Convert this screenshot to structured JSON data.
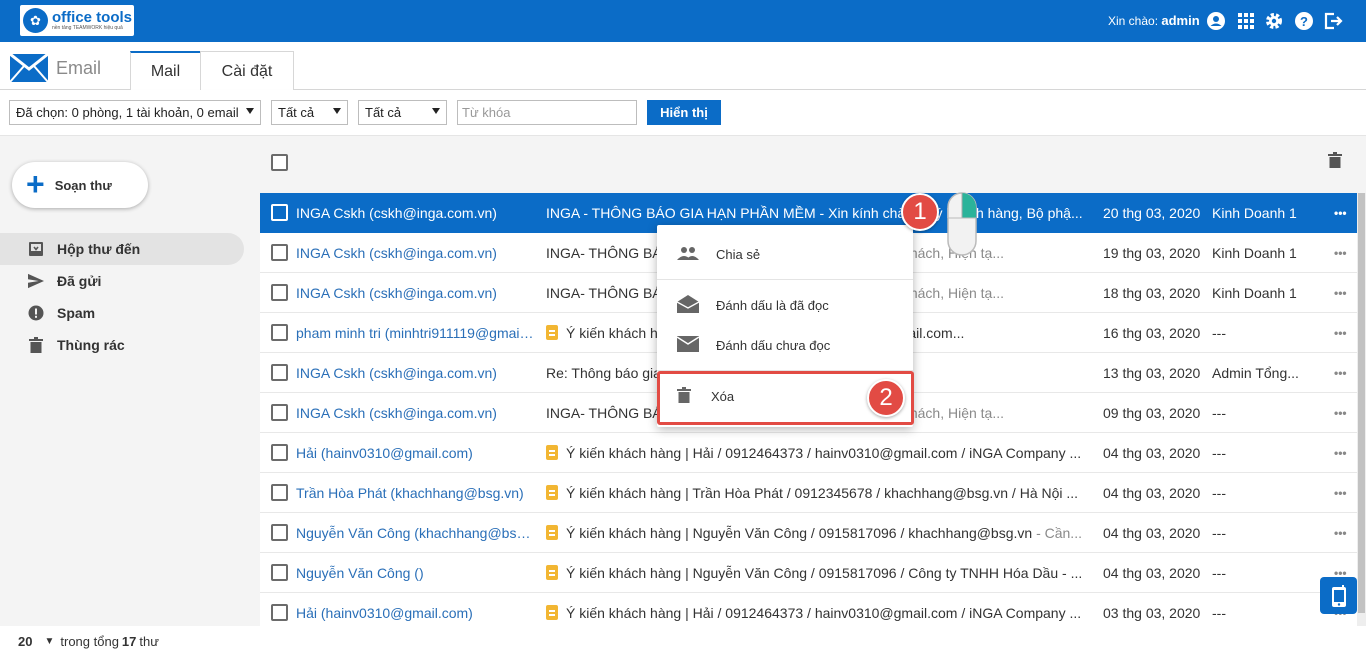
{
  "header": {
    "logo_name": "office tools",
    "logo_tagline": "nền tảng TEAMWORK hiệu quả",
    "greeting_prefix": "Xin chào:",
    "username": "admin",
    "icons": [
      "account-circle-icon",
      "apps-grid-icon",
      "settings-gear-icon",
      "help-icon",
      "logout-icon"
    ]
  },
  "tabs_bar": {
    "module_label": "Email",
    "tabs": [
      {
        "label": "Mail",
        "active": true
      },
      {
        "label": "Cài đặt",
        "active": false
      }
    ]
  },
  "filters": {
    "selection": "Đã chọn: 0 phòng, 1 tài khoản, 0 email",
    "filter_a": "Tất cả",
    "filter_b": "Tất cả",
    "keyword_placeholder": "Từ khóa",
    "keyword_value": "",
    "show_button": "Hiển thị"
  },
  "sidebar": {
    "compose_label": "Soạn thư",
    "items": [
      {
        "label": "Hộp thư đến",
        "icon": "inbox-icon",
        "active": true
      },
      {
        "label": "Đã gửi",
        "icon": "send-icon",
        "active": false
      },
      {
        "label": "Spam",
        "icon": "spam-alert-icon",
        "active": false
      },
      {
        "label": "Thùng rác",
        "icon": "trash-icon",
        "active": false
      }
    ]
  },
  "emails": [
    {
      "sender": "INGA Cskh (cskh@inga.com.vn)",
      "tag": false,
      "subject": "INGA - THÔNG BÁO GIA HẠN PHẦN MỀM - Xin kính chào Quý khách hàng, Bộ phậ...",
      "preview": "",
      "date": "20 thg 03, 2020",
      "dept": "Kinh Doanh 1",
      "selected": true
    },
    {
      "sender": "INGA Cskh (cskh@inga.com.vn)",
      "tag": false,
      "subject": "INGA- THÔNG BÁO GIA HẠN PHẦN MỀM",
      "preview": " - Xin gửi Quý khách, Hiện tạ...",
      "date": "19 thg 03, 2020",
      "dept": "Kinh Doanh 1",
      "selected": false
    },
    {
      "sender": "INGA Cskh (cskh@inga.com.vn)",
      "tag": false,
      "subject": "INGA- THÔNG BÁO GIA HẠN PHẦN MỀM",
      "preview": " - Xin gửi Quý khách, Hiện tạ...",
      "date": "18 thg 03, 2020",
      "dept": "Kinh Doanh 1",
      "selected": false
    },
    {
      "sender": "pham minh tri (minhtri911119@gmail.com)",
      "tag": true,
      "subject": "Ý kiến khách hàng | pham minh tri / minhtri911119@gmail.com...",
      "preview": "",
      "date": "16 thg 03, 2020",
      "dept": "---",
      "selected": false
    },
    {
      "sender": "INGA Cskh (cskh@inga.com.vn)",
      "tag": false,
      "subject": "Re: Thông báo gia hạn",
      "preview": " - INGA gửi, tôi sẽ thu xếp gia ...",
      "date": "13 thg 03, 2020",
      "dept": "Admin Tổng...",
      "selected": false
    },
    {
      "sender": "INGA Cskh (cskh@inga.com.vn)",
      "tag": false,
      "subject": "INGA- THÔNG BÁO GIA HẠN PHẦN MỀM",
      "preview": " - Xin gửi Quý khách, Hiện tạ...",
      "date": "09 thg 03, 2020",
      "dept": "---",
      "selected": false
    },
    {
      "sender": "Hải (hainv0310@gmail.com)",
      "tag": true,
      "subject": "Ý kiến khách hàng | Hải / 0912464373 / hainv0310@gmail.com / iNGA Company ...",
      "preview": "",
      "date": "04 thg 03, 2020",
      "dept": "---",
      "selected": false
    },
    {
      "sender": "Trần Hòa Phát (khachhang@bsg.vn)",
      "tag": true,
      "subject": "Ý kiến khách hàng | Trần Hòa Phát / 0912345678 / khachhang@bsg.vn / Hà Nội ...",
      "preview": "",
      "date": "04 thg 03, 2020",
      "dept": "---",
      "selected": false
    },
    {
      "sender": "Nguyễn Văn Công (khachhang@bsg.vn)",
      "tag": true,
      "subject": "Ý kiến khách hàng | Nguyễn Văn Công / 0915817096 / khachhang@bsg.vn",
      "preview": " - Cần...",
      "date": "04 thg 03, 2020",
      "dept": "---",
      "selected": false
    },
    {
      "sender": "Nguyễn Văn Công ()",
      "tag": true,
      "subject": "Ý kiến khách hàng | Nguyễn Văn Công / 0915817096 / Công ty TNHH Hóa Dầu - ...",
      "preview": "",
      "date": "04 thg 03, 2020",
      "dept": "---",
      "selected": false
    },
    {
      "sender": "Hải (hainv0310@gmail.com)",
      "tag": true,
      "subject": "Ý kiến khách hàng | Hải / 0912464373 / hainv0310@gmail.com / iNGA Company ...",
      "preview": "",
      "date": "03 thg 03, 2020",
      "dept": "---",
      "selected": false
    }
  ],
  "context_menu": {
    "items": [
      {
        "label": "Chia sẻ",
        "icon": "share-people-icon"
      },
      {
        "label": "Đánh dấu là đã đọc",
        "icon": "mail-open-icon"
      },
      {
        "label": "Đánh dấu chưa đọc",
        "icon": "mail-closed-icon"
      },
      {
        "label": "Xóa",
        "icon": "trash-icon"
      }
    ]
  },
  "annotations": {
    "step1": "1",
    "step2": "2"
  },
  "footer": {
    "per_page": "20",
    "text_prefix": "trong tổng",
    "total": "17",
    "text_suffix": "thư"
  },
  "colors": {
    "primary": "#0b6cc7",
    "annotation_red": "#e24b44",
    "tag_yellow": "#f2b632"
  }
}
